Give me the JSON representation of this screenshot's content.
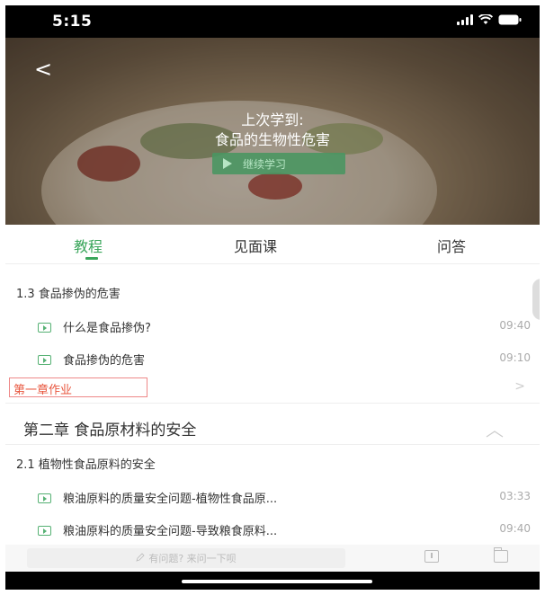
{
  "status": {
    "time": "5:15"
  },
  "banner": {
    "back": "<",
    "subtitle": "上次学到:",
    "title": "食品的生物性危害",
    "continue_label": "继续学习"
  },
  "tabs": [
    {
      "label": "教程",
      "active": true
    },
    {
      "label": "见面课"
    },
    {
      "label": "问答"
    }
  ],
  "sections": {
    "s13": "1.3 食品掺伪的危害",
    "s13_lessons": [
      {
        "title": "什么是食品掺伪?",
        "duration": "09:40"
      },
      {
        "title": "食品掺伪的危害",
        "duration": "09:10"
      }
    ],
    "homework": "第一章作业",
    "homework_arrow": ">",
    "chapter2": "第二章 食品原材料的安全",
    "s21": "2.1 植物性食品原料的安全",
    "s21_lessons": [
      {
        "title": "粮油原料的质量安全问题-植物性食品原...",
        "duration": "03:33"
      },
      {
        "title": "粮油原料的质量安全问题-导致粮食原料...",
        "duration": "09:40"
      }
    ]
  },
  "bottom": {
    "ask_placeholder": "有问题? 来问一下呗"
  },
  "colors": {
    "accent": "#3aa65b",
    "homework": "#e8563e"
  }
}
